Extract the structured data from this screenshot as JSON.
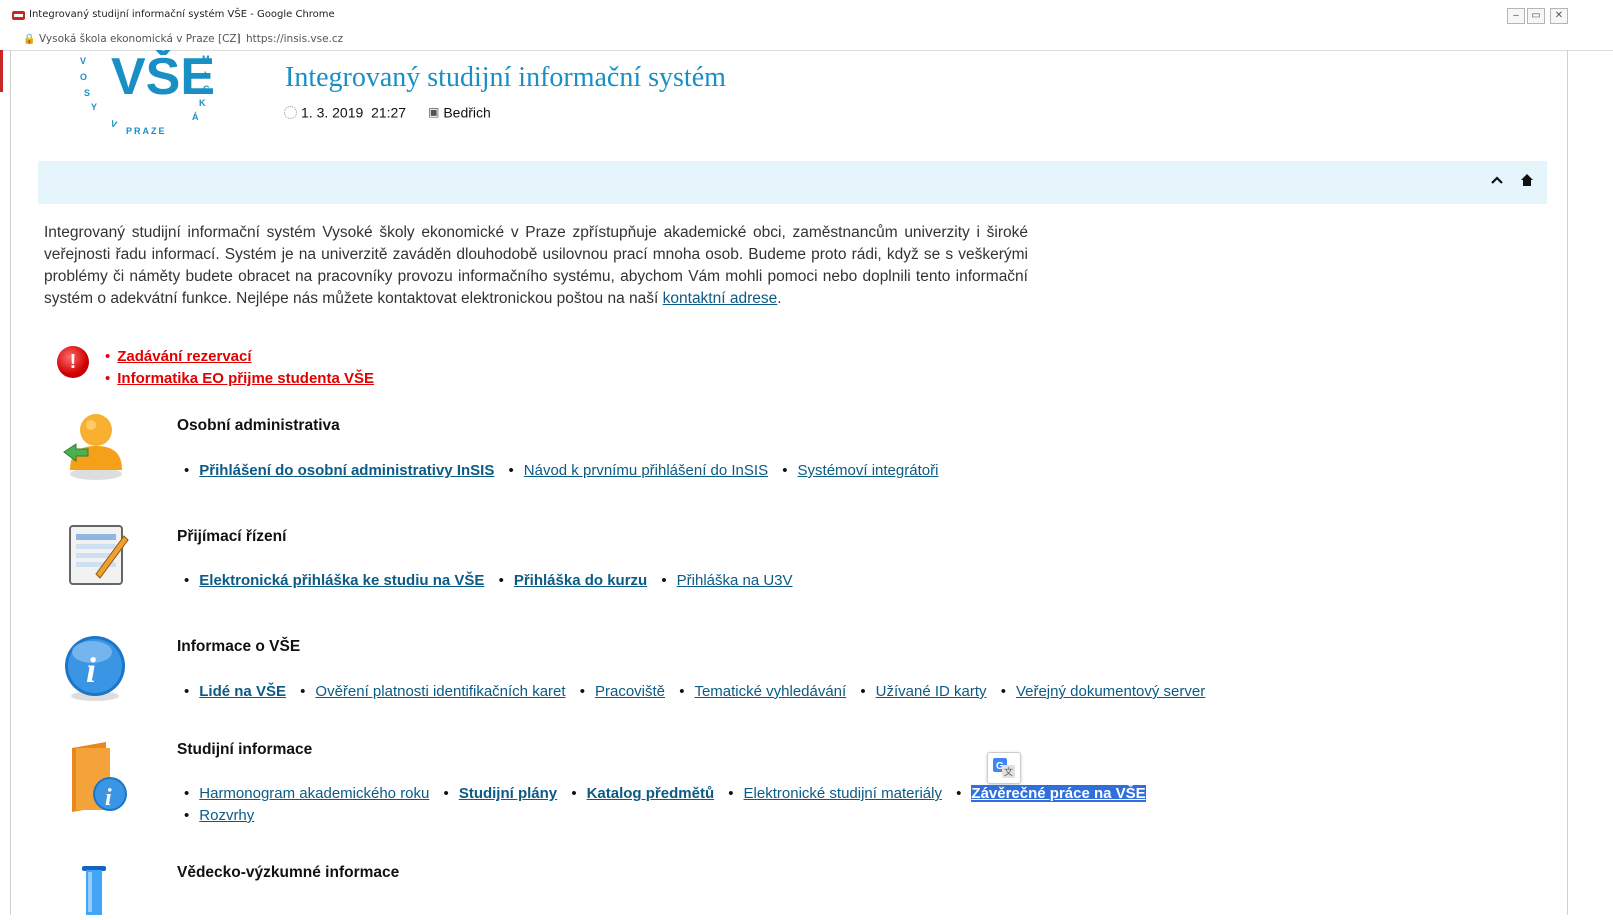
{
  "window": {
    "title": "Integrovaný studijní informační systém VŠE - Google Chrome",
    "controls": [
      "–",
      "▭",
      "✕"
    ]
  },
  "addressbar": {
    "site": "Vysoká škola ekonomická v Praze [CZ]",
    "separator": "|",
    "url": "https://insis.vse.cz"
  },
  "header": {
    "logo_text": "VŠE",
    "logo_arc_left": "VYSOKÁ",
    "logo_arc_right": "MICKÁ",
    "logo_bottom": "V PRAZE",
    "title": "Integrovaný studijní informační systém",
    "date": "1. 3. 2019",
    "time": "21:27",
    "nameday": "Bedřich"
  },
  "intro": {
    "text": "Integrovaný studijní informační systém Vysoké školy ekonomické v Praze zpřístupňuje akademické obci, zaměstnancům univerzity i široké veřejnosti řadu informací. Systém je na univerzitě zaváděn dlouhodobě usilovnou prací mnoha osob. Budeme proto rádi, když se s veškerými problémy či náměty budete obracet na pracovníky provozu informačního systému, abychom Vám mohli pomoci nebo doplnili tento informační systém o adekvátní funkce. Nejlépe nás můžete kontaktovat elektronickou poštou na naší",
    "link": "kontaktní adrese",
    "end": "."
  },
  "alerts": {
    "icon": "!",
    "items": [
      "Zadávání rezervací",
      "Informatika EO přijme studenta VŠE"
    ]
  },
  "sections": [
    {
      "title": "Osobní administrativa",
      "icon": "user-icon",
      "links": [
        "Přihlášení do osobní administrativy InSIS",
        "Návod k prvnímu přihlášení do InSIS",
        "Systémoví integrátoři"
      ]
    },
    {
      "title": "Přijímací řízení",
      "icon": "application-form-icon",
      "links": [
        "Elektronická přihláška ke studiu na VŠE",
        "Přihláška do kurzu",
        "Přihláška na U3V"
      ]
    },
    {
      "title": "Informace o VŠE",
      "icon": "info-icon",
      "links": [
        "Lidé na VŠE",
        "Ověření platnosti identifikačních karet",
        "Pracoviště",
        "Tematické vyhledávání",
        "Užívané ID karty",
        "Veřejný dokumentový server"
      ]
    },
    {
      "title": "Studijní informace",
      "icon": "study-info-icon",
      "links": [
        "Harmonogram akademického roku",
        "Studijní plány",
        "Katalog předmětů",
        "Elektronické studijní materiály",
        "Závěrečné práce na VŠE",
        "Rozvrhy"
      ]
    },
    {
      "title": "Vědecko-výzkumné informace",
      "icon": "test-tube-icon",
      "links": []
    }
  ],
  "colors": {
    "accent": "#1a8fc4",
    "link": "#0b5b86",
    "alert": "#e20000",
    "nav_band": "#e6f5fb",
    "selection": "#2f6fdc"
  }
}
